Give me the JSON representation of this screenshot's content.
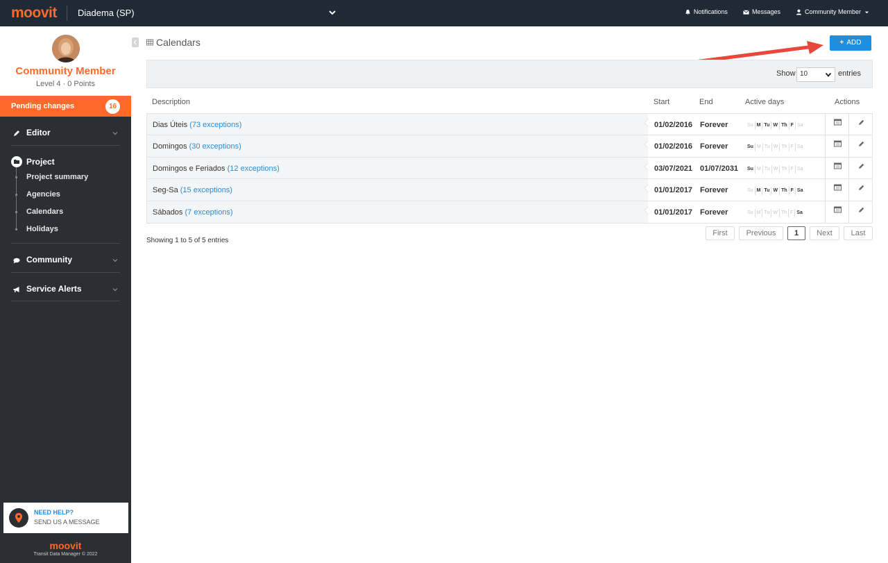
{
  "topbar": {
    "logo": "moovit",
    "city": "Diadema (SP)",
    "notifications": "Notifications",
    "messages": "Messages",
    "user": "Community Member"
  },
  "profile": {
    "name": "Community Member",
    "level": "Level 4 · 0 Points"
  },
  "pending": {
    "label": "Pending changes",
    "count": "16"
  },
  "nav": {
    "editor": "Editor",
    "project": "Project",
    "project_items": [
      "Project summary",
      "Agencies",
      "Calendars",
      "Holidays"
    ],
    "community": "Community",
    "service_alerts": "Service Alerts"
  },
  "help": {
    "title": "NEED HELP?",
    "subtitle": "SEND US A MESSAGE"
  },
  "footer": {
    "logo": "moovit",
    "copyright": "Transit Data Manager © 2022"
  },
  "page": {
    "title": "Calendars",
    "add_label": "ADD"
  },
  "filter": {
    "show_label": "Show",
    "show_value": "10",
    "entries_label": "entries"
  },
  "table": {
    "headers": {
      "description": "Description",
      "start": "Start",
      "end": "End",
      "active_days": "Active days",
      "actions": "Actions"
    },
    "day_labels": [
      "Su",
      "M",
      "Tu",
      "W",
      "Th",
      "F",
      "Sa"
    ],
    "rows": [
      {
        "name": "Dias Úteis",
        "exceptions": "(73 exceptions)",
        "start": "01/02/2016",
        "end": "Forever",
        "days": [
          false,
          true,
          true,
          true,
          true,
          true,
          false
        ]
      },
      {
        "name": "Domingos",
        "exceptions": "(30 exceptions)",
        "start": "01/02/2016",
        "end": "Forever",
        "days": [
          true,
          false,
          false,
          false,
          false,
          false,
          false
        ]
      },
      {
        "name": "Domingos e Feriados",
        "exceptions": "(12 exceptions)",
        "start": "03/07/2021",
        "end": "01/07/2031",
        "days": [
          true,
          false,
          false,
          false,
          false,
          false,
          false
        ]
      },
      {
        "name": "Seg-Sa",
        "exceptions": "(15 exceptions)",
        "start": "01/01/2017",
        "end": "Forever",
        "days": [
          false,
          true,
          true,
          true,
          true,
          true,
          true
        ]
      },
      {
        "name": "Sábados",
        "exceptions": "(7 exceptions)",
        "start": "01/01/2017",
        "end": "Forever",
        "days": [
          false,
          false,
          false,
          false,
          false,
          false,
          true
        ]
      }
    ]
  },
  "pagination": {
    "info": "Showing 1 to 5 of 5 entries",
    "first": "First",
    "previous": "Previous",
    "current": "1",
    "next": "Next",
    "last": "Last"
  },
  "colors": {
    "brand": "#ff6a2b",
    "topbar": "#1f2a36",
    "sidebar": "#2b2f33",
    "link": "#2a8cd6",
    "add_button": "#1e8fe0",
    "annotation_arrow": "#e8473c"
  }
}
